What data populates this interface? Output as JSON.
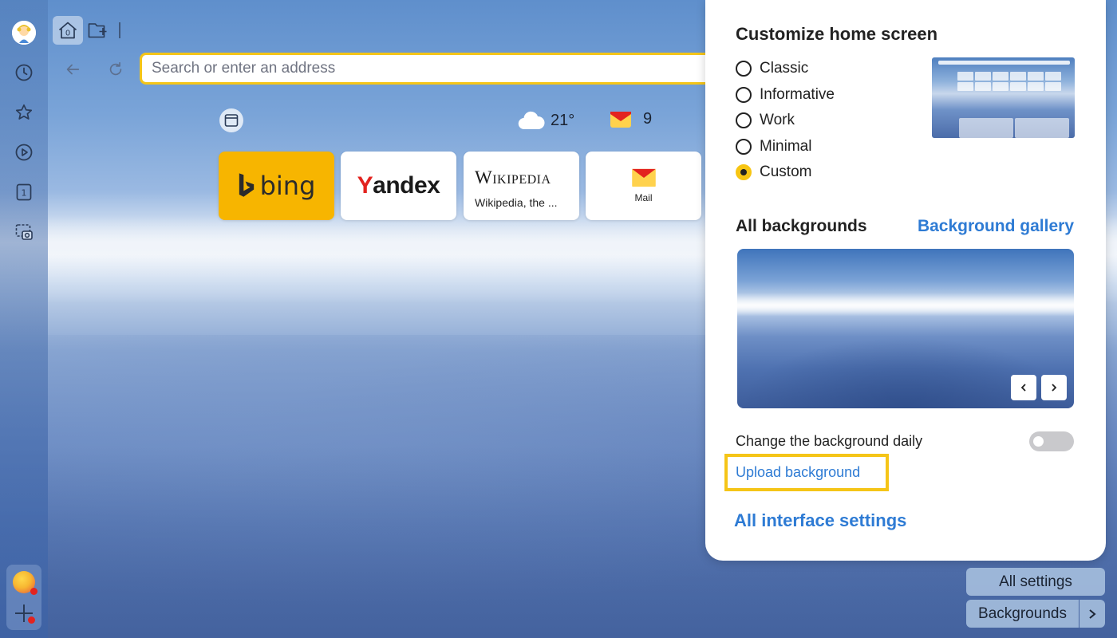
{
  "toolbar": {
    "home_tab_count": "0",
    "address_placeholder": "Search or enter an address"
  },
  "sidebar": {
    "downloads_badge": "1",
    "items": [
      {
        "icon": "history-icon"
      },
      {
        "icon": "bookmarks-star-icon"
      },
      {
        "icon": "video-play-icon"
      },
      {
        "icon": "tab-counter-icon"
      },
      {
        "icon": "screenshot-icon"
      }
    ]
  },
  "widgets": {
    "weather_temp": "21°",
    "mail_count": "9"
  },
  "tiles": [
    {
      "name": "bing",
      "label": "bing",
      "color": "#f7b500"
    },
    {
      "name": "yandex",
      "first": "Y",
      "rest": "andex"
    },
    {
      "name": "wikipedia",
      "logo": "Wikipedia",
      "subtitle": "Wikipedia, the ..."
    },
    {
      "name": "mail",
      "label": "Mail"
    }
  ],
  "panel": {
    "title": "Customize home screen",
    "layouts": [
      {
        "label": "Classic",
        "selected": false
      },
      {
        "label": "Informative",
        "selected": false
      },
      {
        "label": "Work",
        "selected": false
      },
      {
        "label": "Minimal",
        "selected": false
      },
      {
        "label": "Custom",
        "selected": true
      }
    ],
    "backgrounds_heading": "All backgrounds",
    "background_gallery_link": "Background gallery",
    "change_daily_label": "Change the background daily",
    "change_daily_enabled": false,
    "upload_label": "Upload background",
    "all_interface_settings": "All interface settings"
  },
  "bottom_buttons": {
    "all_settings": "All settings",
    "backgrounds": "Backgrounds"
  },
  "colors": {
    "accent_yellow": "#f5c518",
    "link_blue": "#2e7bd4",
    "mail_red": "#e3231f"
  }
}
